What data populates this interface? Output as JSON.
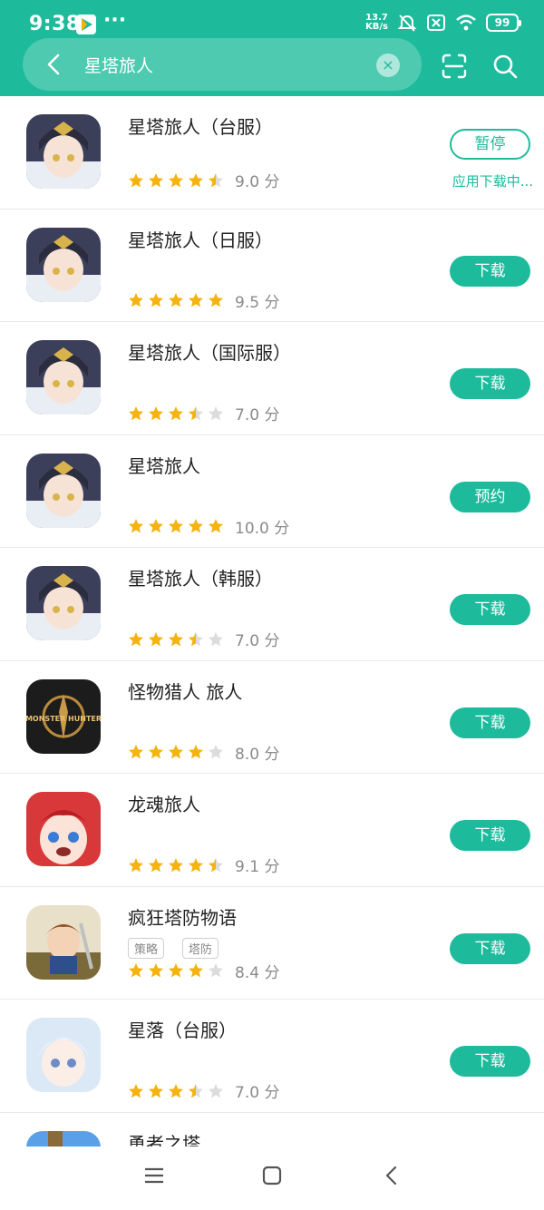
{
  "status_bar": {
    "time": "9:38",
    "net_speed_top": "13.7",
    "net_speed_bottom": "KB/s",
    "battery": "99"
  },
  "search": {
    "query": "星塔旅人",
    "clear_symbol": "×"
  },
  "colors": {
    "accent": "#1dbb9c",
    "star": "#f5b30f",
    "star_empty": "#dcdcdc"
  },
  "apps": [
    {
      "name": "星塔旅人（台服）",
      "stars": 4.5,
      "score": "9.0 分",
      "button": "暂停",
      "button_style": "outline",
      "status": "应用下载中...",
      "tags": []
    },
    {
      "name": "星塔旅人（日服）",
      "stars": 5,
      "score": "9.5 分",
      "button": "下载",
      "tags": []
    },
    {
      "name": "星塔旅人（国际服）",
      "stars": 3.5,
      "score": "7.0 分",
      "button": "下载",
      "tags": []
    },
    {
      "name": "星塔旅人",
      "stars": 5,
      "score": "10.0 分",
      "button": "预约",
      "tags": []
    },
    {
      "name": "星塔旅人（韩服）",
      "stars": 3.5,
      "score": "7.0 分",
      "button": "下载",
      "tags": []
    },
    {
      "name": "怪物猎人 旅人",
      "stars": 4,
      "score": "8.0 分",
      "button": "下载",
      "tags": [],
      "icon_text": "MONSTER HUNTER"
    },
    {
      "name": "龙魂旅人",
      "stars": 4.5,
      "score": "9.1 分",
      "button": "下载",
      "tags": []
    },
    {
      "name": "疯狂塔防物语",
      "stars": 4,
      "score": "8.4 分",
      "button": "下载",
      "tags": [
        "策略",
        "塔防"
      ]
    },
    {
      "name": "星落（台服）",
      "stars": 3.5,
      "score": "7.0 分",
      "button": "下载",
      "tags": []
    },
    {
      "name": "勇者之塔",
      "tags": []
    }
  ]
}
